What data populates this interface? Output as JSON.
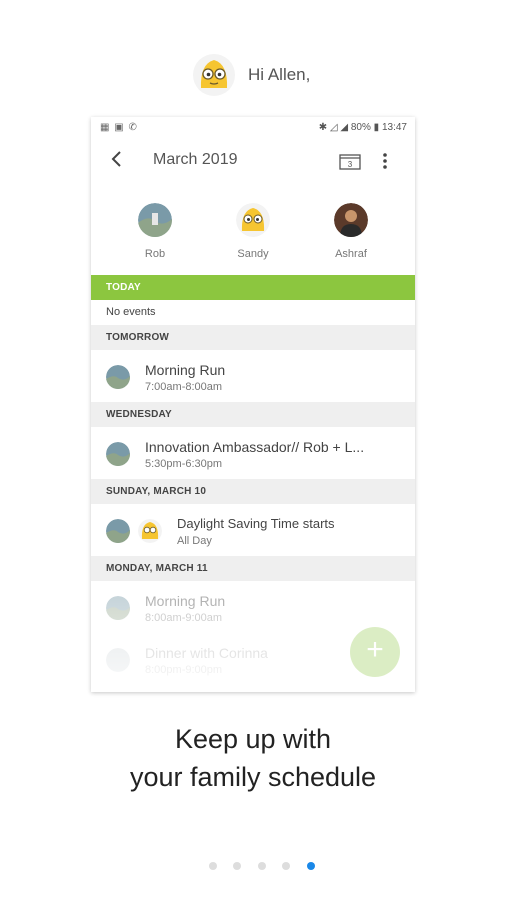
{
  "greeting": {
    "text": "Hi Allen,"
  },
  "status_bar": {
    "battery": "80%",
    "time": "13:47"
  },
  "app_bar": {
    "title": "March 2019",
    "calendar_day": "3"
  },
  "members": [
    {
      "name": "Rob"
    },
    {
      "name": "Sandy"
    },
    {
      "name": "Ashraf"
    }
  ],
  "schedule": {
    "today_header": "TODAY",
    "today_empty": "No events",
    "tomorrow_header": "TOMORROW",
    "tomorrow_events": [
      {
        "title": "Morning Run",
        "time": "7:00am-8:00am"
      }
    ],
    "wednesday_header": "WEDNESDAY",
    "wednesday_events": [
      {
        "title": "Innovation Ambassador// Rob + L...",
        "time": "5:30pm-6:30pm"
      }
    ],
    "sunday_header": "SUNDAY, MARCH 10",
    "sunday_events": [
      {
        "title": "Daylight Saving Time starts",
        "time": "All Day"
      }
    ],
    "monday_header": "MONDAY, MARCH 11",
    "monday_events": [
      {
        "title": "Morning Run",
        "time": "8:00am-9:00am"
      },
      {
        "title": "Dinner with Corinna",
        "time": "8:00pm-9:00pm"
      }
    ]
  },
  "fab": {
    "label": "+"
  },
  "tagline": {
    "line1": "Keep up with",
    "line2": "your family schedule"
  },
  "pager": {
    "count": 5,
    "active_index": 4
  },
  "colors": {
    "accent_green": "#8cc63f",
    "pager_active": "#1a88e8"
  }
}
